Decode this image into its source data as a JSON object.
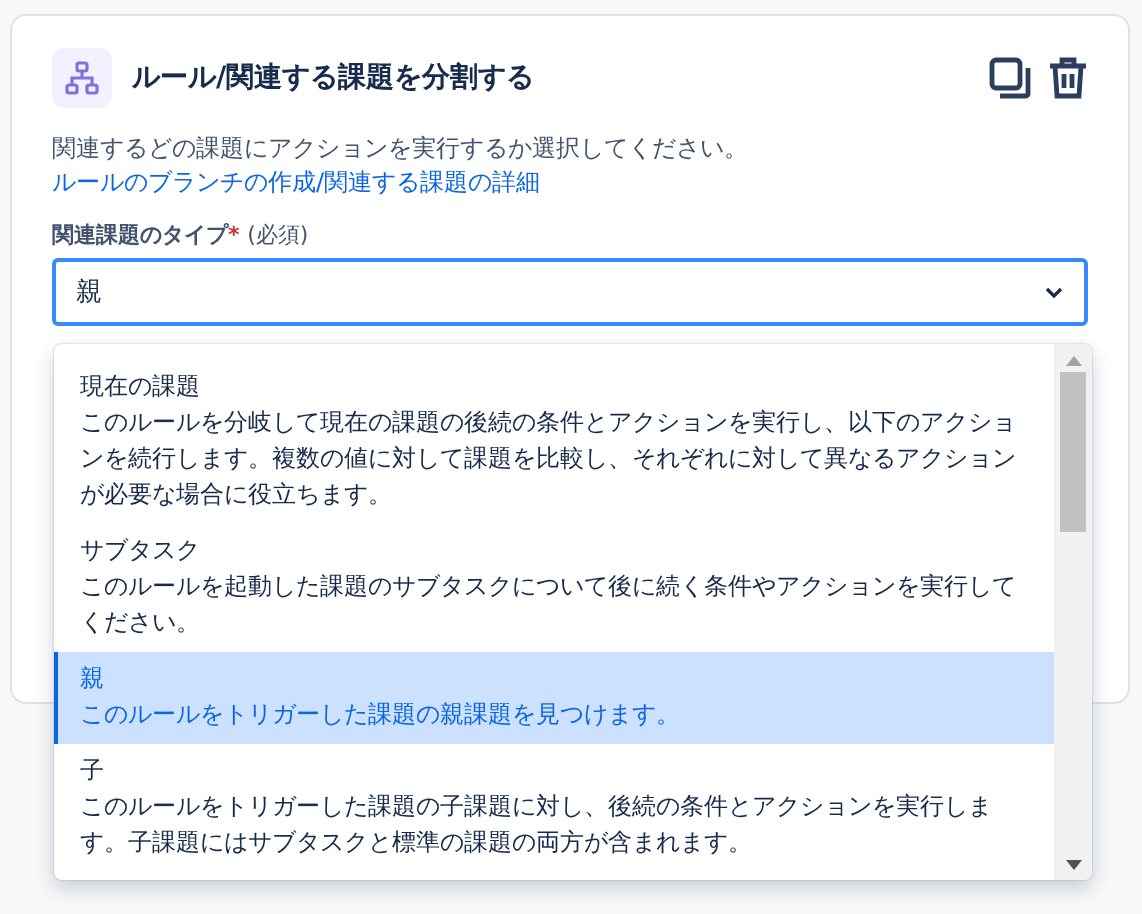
{
  "card": {
    "title": "ルール/関連する課題を分割する",
    "description": "関連するどの課題にアクションを実行するか選択してください。",
    "link": "ルールのブランチの作成/関連する課題の詳細",
    "field": {
      "label": "関連課題のタイプ",
      "required_mark": "*",
      "required_text": "(必須)",
      "value": "親",
      "focused": true
    }
  },
  "dropdown": {
    "options": [
      {
        "title": "現在の課題",
        "description": "このルールを分岐して現在の課題の後続の条件とアクションを実行し、以下のアクションを続行します。複数の値に対して課題を比較し、それぞれに対して異なるアクションが必要な場合に役立ちます。",
        "selected": false
      },
      {
        "title": "サブタスク",
        "description": "このルールを起動した課題のサブタスクについて後に続く条件やアクションを実行してください。",
        "selected": false
      },
      {
        "title": "親",
        "description": "このルールをトリガーした課題の親課題を見つけます。",
        "selected": true
      },
      {
        "title": "子",
        "description": "このルールをトリガーした課題の子課題に対し、後続の条件とアクションを実行します。子課題にはサブタスクと標準の課題の両方が含まれます。",
        "selected": false
      }
    ]
  }
}
